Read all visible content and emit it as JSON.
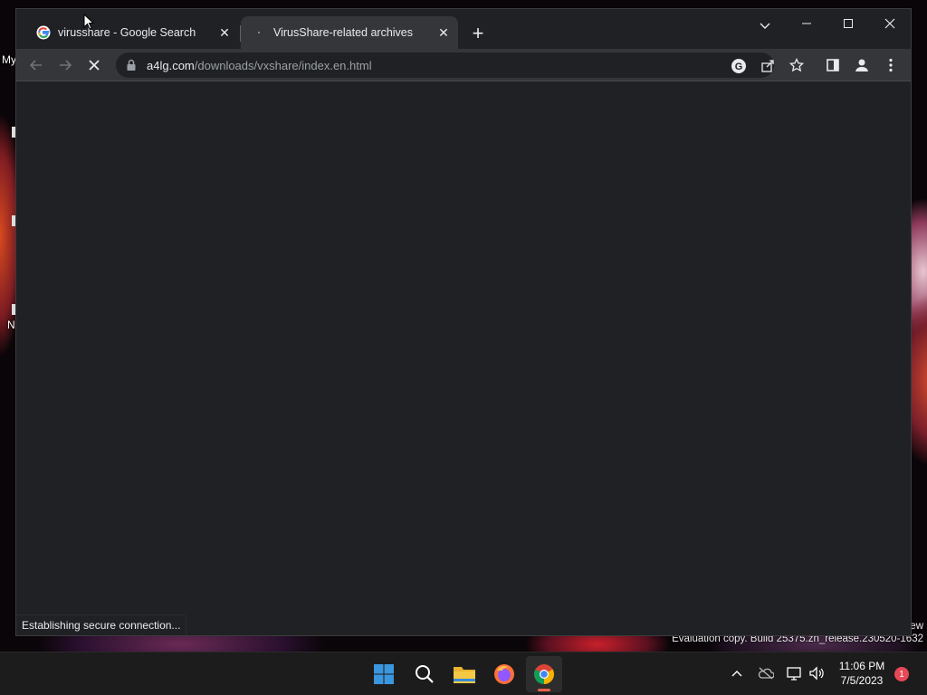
{
  "desktop": {
    "partial_labels": [
      "My",
      "N"
    ],
    "eval_partial": "ew",
    "eval_text": "Evaluation copy. Build 25375.zn_release.230520-1632"
  },
  "browser": {
    "tabs": [
      {
        "title": "virusshare - Google Search",
        "favicon": "google-favicon",
        "active": false
      },
      {
        "title": "VirusShare-related archives",
        "favicon": "loading-favicon",
        "active": true
      }
    ],
    "tab_close_glyph": "✕",
    "new_tab_glyph": "+",
    "url": {
      "host": "a4lg.com",
      "path": "/downloads/vxshare/index.en.html"
    },
    "status_text": "Establishing secure connection...",
    "toolbar_icons": [
      "back-icon",
      "forward-icon",
      "stop-icon",
      "lock-icon",
      "google-lens-icon",
      "share-icon",
      "bookmark-star-icon",
      "side-panel-icon",
      "profile-icon",
      "menu-icon"
    ],
    "window_controls": [
      "minimize-icon",
      "maximize-icon",
      "close-icon"
    ]
  },
  "taskbar": {
    "apps": [
      "windows-start-icon",
      "search-icon",
      "file-explorer-icon",
      "firefox-icon",
      "chrome-icon"
    ],
    "active_app": "chrome-icon",
    "time": "11:06 PM",
    "date": "7/5/2023",
    "notification_count": "1"
  },
  "colors": {
    "window_bg": "#202124",
    "toolbar_bg": "#35363a",
    "taskbar_bg": "#1c1c1c",
    "accent": "#e8624a",
    "badge": "#e74856"
  }
}
